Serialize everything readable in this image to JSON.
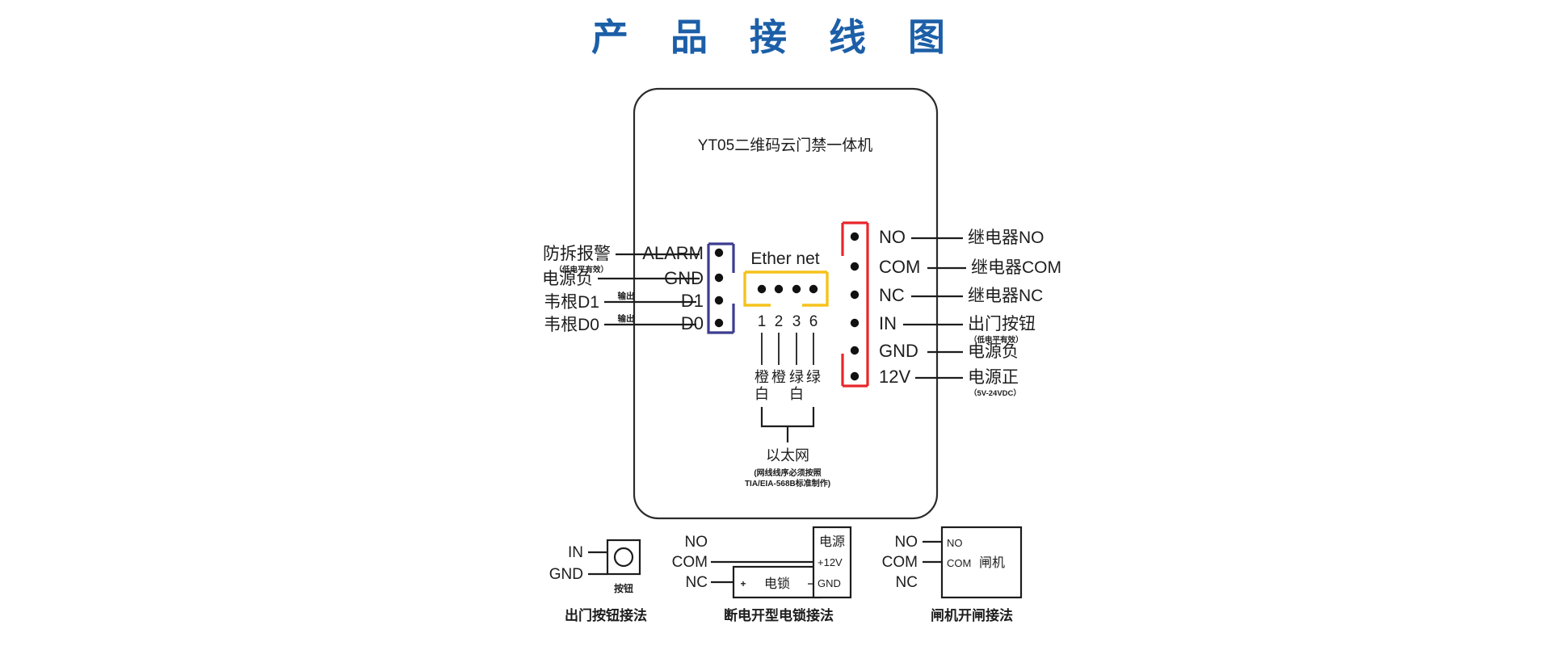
{
  "page": {
    "title": "产 品 接 线 图",
    "title_color": "#1c5fa8",
    "background": "#ffffff"
  },
  "device": {
    "name": "YT05二维码云门禁一体机",
    "body_border_color": "#2b2b2b"
  },
  "left_terminal": {
    "bracket_color": "#3c3c8f",
    "pins": [
      {
        "pin": "ALARM",
        "label": "防拆报警",
        "sub": "（低电平有效）",
        "mid": ""
      },
      {
        "pin": "GND",
        "label": "电源负",
        "sub": "",
        "mid": ""
      },
      {
        "pin": "D1",
        "label": "韦根D1",
        "sub": "",
        "mid": "输出"
      },
      {
        "pin": "D0",
        "label": "韦根D0",
        "sub": "",
        "mid": "输出"
      }
    ]
  },
  "right_terminal": {
    "bracket_color": "#e8262b",
    "pins": [
      {
        "pin": "NO",
        "label": "继电器NO",
        "sub": ""
      },
      {
        "pin": "COM",
        "label": "继电器COM",
        "sub": ""
      },
      {
        "pin": "NC",
        "label": "继电器NC",
        "sub": ""
      },
      {
        "pin": "IN",
        "label": "出门按钮",
        "sub": "（低电平有效）"
      },
      {
        "pin": "GND",
        "label": "电源负",
        "sub": ""
      },
      {
        "pin": "12V",
        "label": "电源正",
        "sub": "（5V-24VDC）"
      }
    ]
  },
  "ethernet": {
    "bracket_color": "#f5c21b",
    "title": "Ether net",
    "pin_numbers": [
      "1",
      "2",
      "3",
      "6"
    ],
    "wire_colors_top": [
      "橙",
      "橙",
      "绿",
      "绿"
    ],
    "wire_colors_bottom": [
      "白",
      "",
      "白",
      ""
    ],
    "group_label": "以太网",
    "note_line1": "(网线线序必须按照",
    "note_line2": "TIA/EIA-568B标准制作)"
  },
  "sub_diagrams": [
    {
      "id": "exit-button",
      "caption": "出门按钮接法",
      "pins": [
        "IN",
        "GND"
      ],
      "box_label": "",
      "box_caption": "按钮"
    },
    {
      "id": "power-off-lock",
      "caption": "断电开型电锁接法",
      "pins": [
        "NO",
        "COM",
        "NC"
      ],
      "lock_label": "电锁",
      "lock_plus": "+",
      "lock_minus": "−",
      "supply_label": "电源",
      "supply_pos": "+12V",
      "supply_gnd": "GND"
    },
    {
      "id": "turnstile",
      "caption": "闸机开闸接法",
      "pins": [
        "NO",
        "COM",
        "NC"
      ],
      "box_label": "闸机",
      "box_pins": [
        "NO",
        "COM"
      ]
    }
  ]
}
